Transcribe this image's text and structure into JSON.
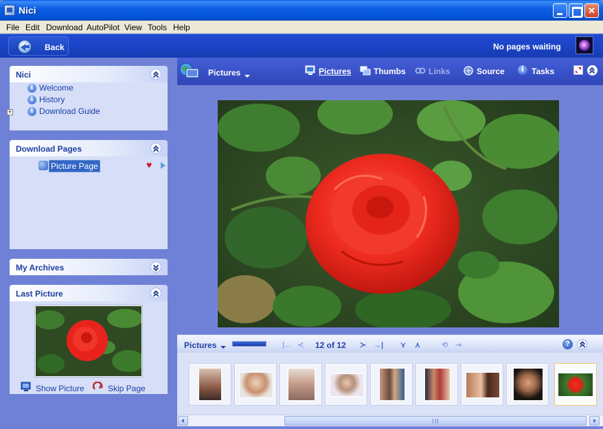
{
  "window": {
    "title": "Nici"
  },
  "menu": [
    "File",
    "Edit",
    "Download",
    "AutoPilot",
    "View",
    "Tools",
    "Help"
  ],
  "backbar": {
    "back_label": "Back",
    "status": "No pages waiting"
  },
  "panels": {
    "nici": {
      "title": "Nici",
      "links": [
        "Welcome",
        "History",
        "Download Guide"
      ]
    },
    "download_pages": {
      "title": "Download Pages",
      "item": "Picture Page"
    },
    "my_archives": {
      "title": "My Archives"
    },
    "last_picture": {
      "title": "Last Picture",
      "show_label": "Show Picture",
      "skip_label": "Skip Page"
    }
  },
  "toolbar": {
    "view_label": "Pictures",
    "tabs": [
      {
        "label": "Pictures",
        "icon": "pictures-icon",
        "state": "active"
      },
      {
        "label": "Thumbs",
        "icon": "thumbs-icon",
        "state": "normal"
      },
      {
        "label": "Links",
        "icon": "links-icon",
        "state": "disabled"
      },
      {
        "label": "Source",
        "icon": "source-icon",
        "state": "normal"
      },
      {
        "label": "Tasks",
        "icon": "info-icon",
        "state": "normal"
      }
    ]
  },
  "filmbar": {
    "label": "Pictures",
    "counter": "12 of 12",
    "progress": 1.0
  },
  "filmstrip": {
    "thumbnails": [
      {
        "subject": "person"
      },
      {
        "subject": "person"
      },
      {
        "subject": "person"
      },
      {
        "subject": "person"
      },
      {
        "subject": "couple"
      },
      {
        "subject": "couple"
      },
      {
        "subject": "couple"
      },
      {
        "subject": "person"
      },
      {
        "subject": "red-rose",
        "selected": true
      }
    ]
  },
  "colors": {
    "titlebar": "#0452d6",
    "panel_bg": "#d6dff7",
    "panel_title": "#1d3f9f",
    "link": "#1a3ea8",
    "rose": "#e8231c"
  }
}
